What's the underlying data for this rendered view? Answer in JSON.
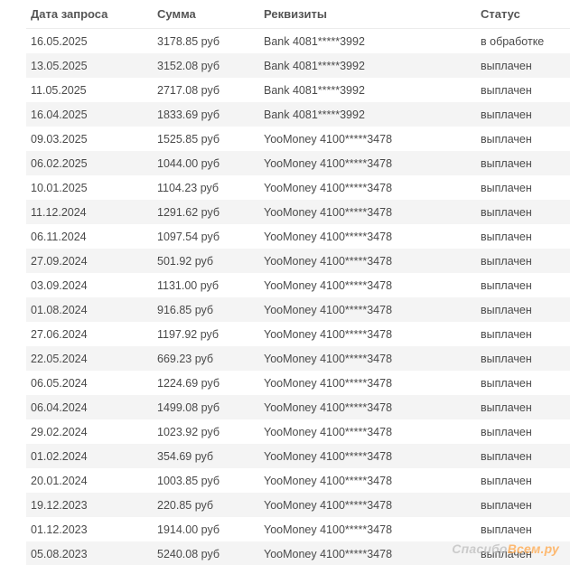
{
  "table": {
    "headers": {
      "date": "Дата запроса",
      "amount": "Сумма",
      "requisites": "Реквизиты",
      "status": "Статус"
    },
    "rows": [
      {
        "date": "16.05.2025",
        "amount": "3178.85 руб",
        "requisites": "Bank 4081*****3992",
        "status": "в обработке"
      },
      {
        "date": "13.05.2025",
        "amount": "3152.08 руб",
        "requisites": "Bank 4081*****3992",
        "status": "выплачен"
      },
      {
        "date": "11.05.2025",
        "amount": "2717.08 руб",
        "requisites": "Bank 4081*****3992",
        "status": "выплачен"
      },
      {
        "date": "16.04.2025",
        "amount": "1833.69 руб",
        "requisites": "Bank 4081*****3992",
        "status": "выплачен"
      },
      {
        "date": "09.03.2025",
        "amount": "1525.85 руб",
        "requisites": "YooMoney 4100*****3478",
        "status": "выплачен"
      },
      {
        "date": "06.02.2025",
        "amount": "1044.00 руб",
        "requisites": "YooMoney 4100*****3478",
        "status": "выплачен"
      },
      {
        "date": "10.01.2025",
        "amount": "1104.23 руб",
        "requisites": "YooMoney 4100*****3478",
        "status": "выплачен"
      },
      {
        "date": "11.12.2024",
        "amount": "1291.62 руб",
        "requisites": "YooMoney 4100*****3478",
        "status": "выплачен"
      },
      {
        "date": "06.11.2024",
        "amount": "1097.54 руб",
        "requisites": "YooMoney 4100*****3478",
        "status": "выплачен"
      },
      {
        "date": "27.09.2024",
        "amount": "501.92 руб",
        "requisites": "YooMoney 4100*****3478",
        "status": "выплачен"
      },
      {
        "date": "03.09.2024",
        "amount": "1131.00 руб",
        "requisites": "YooMoney 4100*****3478",
        "status": "выплачен"
      },
      {
        "date": "01.08.2024",
        "amount": "916.85 руб",
        "requisites": "YooMoney 4100*****3478",
        "status": "выплачен"
      },
      {
        "date": "27.06.2024",
        "amount": "1197.92 руб",
        "requisites": "YooMoney 4100*****3478",
        "status": "выплачен"
      },
      {
        "date": "22.05.2024",
        "amount": "669.23 руб",
        "requisites": "YooMoney 4100*****3478",
        "status": "выплачен"
      },
      {
        "date": "06.05.2024",
        "amount": "1224.69 руб",
        "requisites": "YooMoney 4100*****3478",
        "status": "выплачен"
      },
      {
        "date": "06.04.2024",
        "amount": "1499.08 руб",
        "requisites": "YooMoney 4100*****3478",
        "status": "выплачен"
      },
      {
        "date": "29.02.2024",
        "amount": "1023.92 руб",
        "requisites": "YooMoney 4100*****3478",
        "status": "выплачен"
      },
      {
        "date": "01.02.2024",
        "amount": "354.69 руб",
        "requisites": "YooMoney 4100*****3478",
        "status": "выплачен"
      },
      {
        "date": "20.01.2024",
        "amount": "1003.85 руб",
        "requisites": "YooMoney 4100*****3478",
        "status": "выплачен"
      },
      {
        "date": "19.12.2023",
        "amount": "220.85 руб",
        "requisites": "YooMoney 4100*****3478",
        "status": "выплачен"
      },
      {
        "date": "01.12.2023",
        "amount": "1914.00 руб",
        "requisites": "YooMoney 4100*****3478",
        "status": "выплачен"
      },
      {
        "date": "05.08.2023",
        "amount": "5240.08 руб",
        "requisites": "YooMoney 4100*****3478",
        "status": "выплачен"
      }
    ]
  },
  "watermark": {
    "text_main": "Спасибо",
    "text_accent": "Всем.ру"
  }
}
